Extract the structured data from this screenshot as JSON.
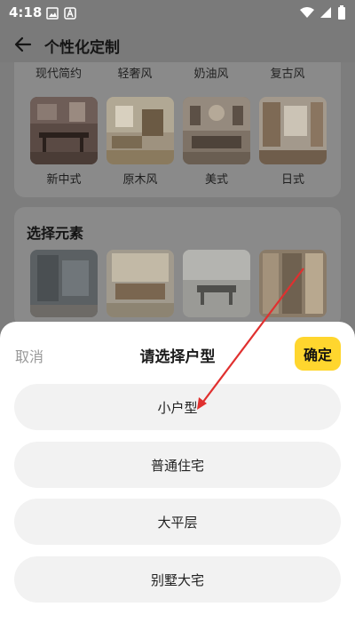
{
  "status_bar": {
    "time": "4:18"
  },
  "header": {
    "title": "个性化定制"
  },
  "styles_partial_labels": [
    "现代简约",
    "轻奢风",
    "奶油风",
    "复古风"
  ],
  "styles_row": [
    {
      "label": "新中式"
    },
    {
      "label": "原木风"
    },
    {
      "label": "美式"
    },
    {
      "label": "日式"
    }
  ],
  "elements_section": {
    "heading": "选择元素"
  },
  "sheet": {
    "cancel_label": "取消",
    "title": "请选择户型",
    "confirm_label": "确定",
    "options": [
      "小户型",
      "普通住宅",
      "大平层",
      "别墅大宅"
    ]
  },
  "colors": {
    "accent": "#ffd62e",
    "annotation_arrow": "#e0302f"
  }
}
